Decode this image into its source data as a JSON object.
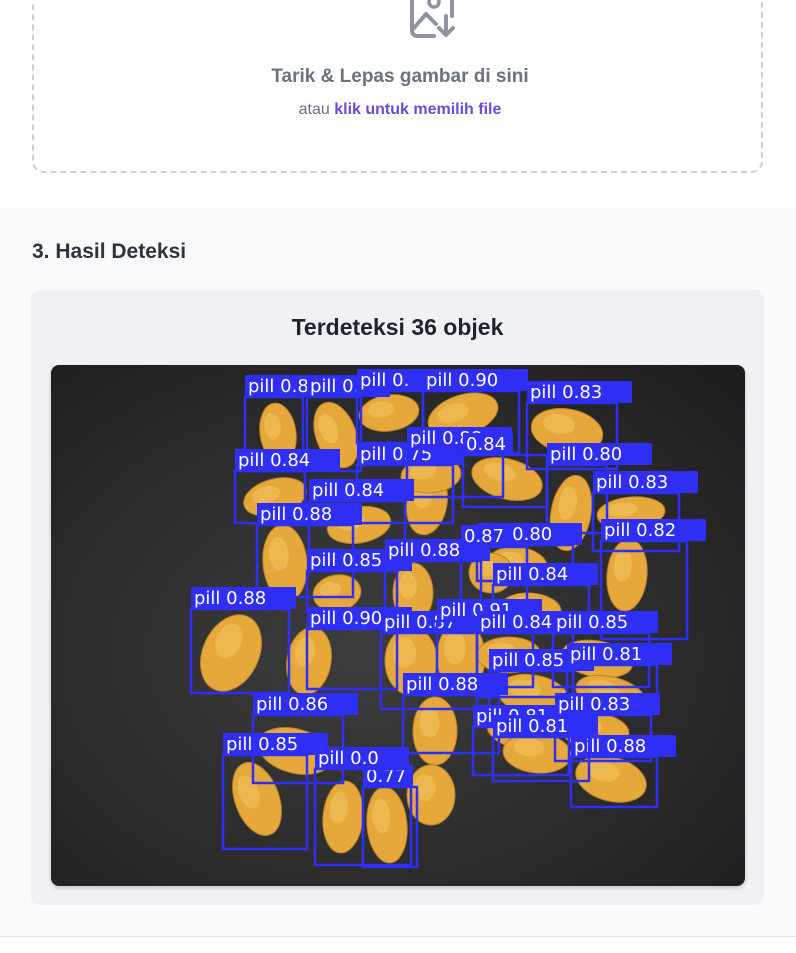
{
  "upload": {
    "icon": "image-download-icon",
    "title": "Tarik & Lepas gambar di sini",
    "sub_prefix": "atau",
    "link_text": "klik untuk memilih file"
  },
  "section": {
    "title": "3. Hasil Deteksi"
  },
  "result": {
    "title": "Terdeteksi 36 objek",
    "box_color": "#2e2ef5",
    "pill_color": "#e6a83a",
    "background_color": "#2b2b2c",
    "detections": [
      {
        "label": "pill 0.8"
      },
      {
        "label": "pill 0."
      },
      {
        "label": "pill 0."
      },
      {
        "label": "pill 0.90"
      },
      {
        "label": "pill 0.83"
      },
      {
        "label": "pill 0.84"
      },
      {
        "label": "pill 0.75"
      },
      {
        "label": "pill 0.88"
      },
      {
        "label": "0.84"
      },
      {
        "label": "pill 0.80"
      },
      {
        "label": "pill 0.83"
      },
      {
        "label": "pill 0.84"
      },
      {
        "label": "pill 0.88"
      },
      {
        "label": "pill 0.80"
      },
      {
        "label": "pill 0.82"
      },
      {
        "label": "pill 0.85"
      },
      {
        "label": "pill 0.88"
      },
      {
        "label": "0.87"
      },
      {
        "label": "pill 0.84"
      },
      {
        "label": "pill 0.88"
      },
      {
        "label": "pill 0.90"
      },
      {
        "label": "pill 0.87"
      },
      {
        "label": "pill 0.91"
      },
      {
        "label": "pill 0.84"
      },
      {
        "label": "pill 0.85"
      },
      {
        "label": "pill 0.85"
      },
      {
        "label": "pill 0.81"
      },
      {
        "label": "pill 0.88"
      },
      {
        "label": "pill 0.86"
      },
      {
        "label": "pill 0.81"
      },
      {
        "label": "pill 0.83"
      },
      {
        "label": "pill 0.85"
      },
      {
        "label": "pill 0.88"
      },
      {
        "label": "pill 0.81"
      },
      {
        "label": "0.77"
      },
      {
        "label": "pill 0.0"
      }
    ]
  }
}
